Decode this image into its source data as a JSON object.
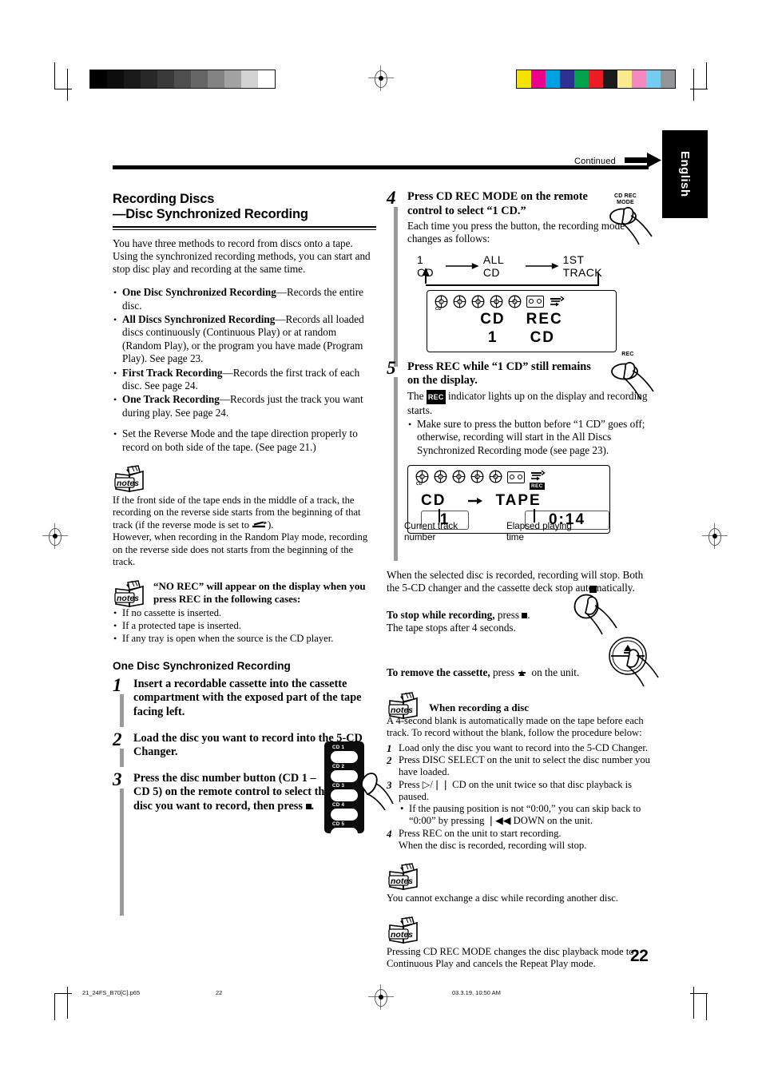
{
  "header": {
    "continued": "Continued",
    "language_tab": "English"
  },
  "left_column": {
    "title_line1": "Recording Discs",
    "title_line2": "—Disc Synchronized Recording",
    "intro": "You have three methods to record from discs onto a tape. Using the synchronized recording methods, you can start and stop disc play and recording at the same time.",
    "methods": [
      {
        "term": "One Disc Synchronized Recording",
        "desc": "—Records the entire disc."
      },
      {
        "term": "All Discs Synchronized Recording",
        "desc": "—Records all loaded discs continuously (Continuous Play) or at random (Random Play), or the program you have made (Program Play). See page 23."
      },
      {
        "term": "First Track Recording",
        "desc": "—Records the first track of each disc. See page 24."
      },
      {
        "term": "One Track Recording",
        "desc": "—Records just the track you want during play. See page 24."
      }
    ],
    "reverse_note": "Set the Reverse Mode and the tape direction properly to record on both side of the tape. (See page 21.)",
    "note1_part1": "If the front side of the tape ends in the middle of a track, the recording on the reverse side starts from the beginning of that track (if the reverse mode is set to",
    "note1_part2": ").",
    "note1_part3": "However, when recording in the Random Play mode, recording on the reverse side does not starts from the beginning of the track.",
    "note2_head": "“NO REC” will appear on the display when you press REC in the following cases:",
    "note2_items": [
      "If no cassette is inserted.",
      "If a protected tape is inserted.",
      "If any tray is open when the source is the CD player."
    ],
    "subheading": "One Disc Synchronized Recording",
    "steps": [
      {
        "num": "1",
        "head": "Insert a recordable cassette into the cassette compartment with the exposed part of the tape facing left."
      },
      {
        "num": "2",
        "head": "Load the disc you want to record into the 5-CD Changer."
      },
      {
        "num": "3",
        "head_a": "Press the disc number button (CD 1 – CD 5) on the remote control to select the disc you want to record, then press",
        "head_b": "."
      }
    ],
    "remote_buttons": [
      "CD 1",
      "CD 2",
      "CD 3",
      "CD 4",
      "CD 5"
    ]
  },
  "right_column": {
    "step4": {
      "num": "4",
      "head": "Press CD REC MODE on the remote control to select “1 CD.”",
      "body": "Each time you press the button, the recording mode changes as follows:",
      "button_label": "CD REC\nMODE",
      "cycle": [
        "1 CD",
        "ALL CD",
        "1ST TRACK"
      ],
      "display": {
        "disc_indicators": [
          "1",
          "2",
          "3",
          "4",
          "5"
        ],
        "cd_label": "CD",
        "line1_left": "CD",
        "line1_right": "REC",
        "line2_left": "1",
        "line2_right": "CD"
      }
    },
    "step5": {
      "num": "5",
      "head": "Press REC while “1 CD” still remains on the display.",
      "body_a": "The",
      "rec_badge": "REC",
      "body_b": "indicator lights up on the display and recording starts.",
      "bullet": "Make sure to press the button before “1 CD” goes off; otherwise, recording will start in the All Discs Synchronized Recording mode (see page 23).",
      "button_label": "REC",
      "display": {
        "disc_indicators": [
          "1",
          "2",
          "3",
          "4",
          "5"
        ],
        "cd_label": "CD",
        "rec_indicator": "REC",
        "source": "CD",
        "target": "TAPE",
        "track_number": "1",
        "elapsed_time": "0:14"
      },
      "callout_left": "Current track\nnumber",
      "callout_right": "Elapsed playing\ntime"
    },
    "after_text": "When the selected disc is recorded, recording will stop. Both the 5-CD changer and the cassette deck stop automatically.",
    "stop_head": "To stop while recording,",
    "stop_rest_a": "press",
    "stop_rest_b": ".",
    "stop_body": "The tape stops after 4 seconds.",
    "remove_head": "To remove the cassette,",
    "remove_rest_a": "press",
    "remove_rest_b": "on the unit.",
    "note3_head": "When recording a disc",
    "note3_body": "A 4-second blank is automatically made on the tape before each track. To record without the blank, follow the procedure below:",
    "note3_steps": [
      {
        "n": "1",
        "t": "Load only the disc you want to record into the 5-CD Changer."
      },
      {
        "n": "2",
        "t": "Press DISC SELECT on the unit to select the disc number you have loaded."
      },
      {
        "n": "3",
        "t": "Press ▷/❘❘ CD on the unit twice so that disc playback is paused.",
        "sub": "If the pausing position is not “0:00,” you can skip back to “0:00” by pressing ❘◀◀ DOWN on the unit."
      },
      {
        "n": "4",
        "t": "Press REC on the unit to start recording.",
        "extra": "When the disc is recorded, recording will stop."
      }
    ],
    "note4_body": "You cannot exchange a disc while recording another disc.",
    "note5_body": "Pressing CD REC MODE changes the disc playback mode to Continuous Play and cancels the Repeat Play mode."
  },
  "footer": {
    "filename": "21_24FS_B70[C].p65",
    "page_marker": "22",
    "timestamp": "03.3.19, 10:50 AM",
    "page_number": "22"
  },
  "calibration": {
    "grayscale": [
      "#000000",
      "#0d0d0d",
      "#1a1a1a",
      "#282828",
      "#3a3a3a",
      "#4e4e4e",
      "#666666",
      "#838383",
      "#a3a3a3",
      "#d2d2d2",
      "#ffffff"
    ],
    "colors": [
      "#f5e400",
      "#ec008c",
      "#00a0e3",
      "#2e3192",
      "#00a34a",
      "#ed1c24",
      "#1b1b1b",
      "#fceb8c",
      "#f489bf",
      "#74cdf0",
      "#939598"
    ]
  }
}
